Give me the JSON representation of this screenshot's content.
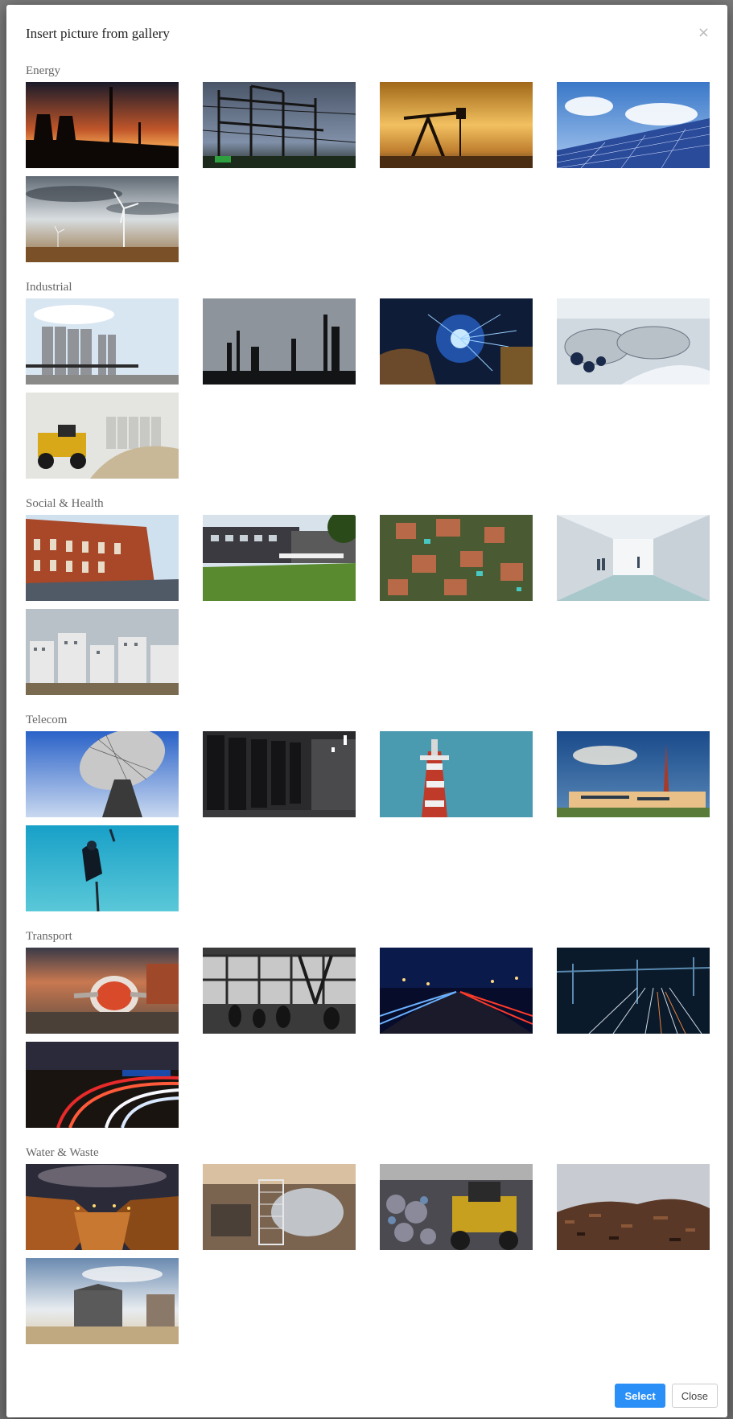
{
  "dialog": {
    "title": "Insert picture from gallery",
    "close_symbol": "×",
    "select_label": "Select",
    "close_label": "Close"
  },
  "categories": [
    {
      "name": "Energy",
      "images": [
        {
          "subject": "power plant cooling towers at sunset"
        },
        {
          "subject": "electrical substation at dusk"
        },
        {
          "subject": "oil pump jack at sunset"
        },
        {
          "subject": "solar panels under cloudy sky"
        },
        {
          "subject": "wind turbines over field"
        }
      ]
    },
    {
      "name": "Industrial",
      "images": [
        {
          "subject": "grain silos"
        },
        {
          "subject": "refinery towers"
        },
        {
          "subject": "welder with sparks"
        },
        {
          "subject": "industrial pipes factory"
        },
        {
          "subject": "loader at cement plant"
        }
      ]
    },
    {
      "name": "Social & Health",
      "images": [
        {
          "subject": "red brick building street"
        },
        {
          "subject": "modern school building with lawn"
        },
        {
          "subject": "aerial view of houses"
        },
        {
          "subject": "hospital corridor"
        },
        {
          "subject": "apartment blocks"
        }
      ]
    },
    {
      "name": "Telecom",
      "images": [
        {
          "subject": "satellite dish"
        },
        {
          "subject": "server room racks"
        },
        {
          "subject": "telecom tower against blue sky"
        },
        {
          "subject": "antenna mast with building"
        },
        {
          "subject": "diver underwater with cable"
        }
      ]
    },
    {
      "name": "Transport",
      "images": [
        {
          "subject": "airplane at gate sunset"
        },
        {
          "subject": "airport terminal silhouettes"
        },
        {
          "subject": "highway light trails at night"
        },
        {
          "subject": "railway tracks at night"
        },
        {
          "subject": "curving road light trails"
        }
      ]
    },
    {
      "name": "Water & Waste",
      "images": [
        {
          "subject": "dam at night with lights"
        },
        {
          "subject": "water treatment machinery"
        },
        {
          "subject": "bulldozer at recycling plant"
        },
        {
          "subject": "scrap metal pile"
        },
        {
          "subject": "water tank building on beach"
        }
      ]
    }
  ],
  "icons": {
    "close": "close-icon"
  },
  "colors": {
    "primary_button": "#2a8ff7"
  }
}
